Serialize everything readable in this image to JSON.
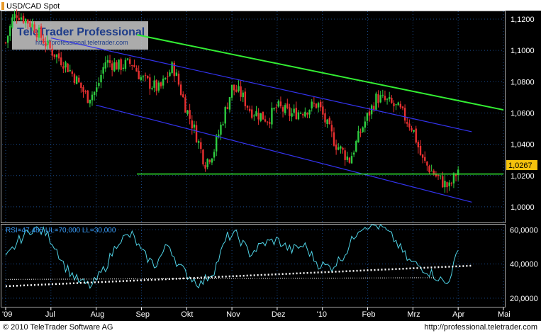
{
  "branding": {
    "logo": "TeleTrader Professional",
    "logo_url": "http://professional.teletrader.com"
  },
  "footer": {
    "copyright": "© 2010 TeleTrader Software AG",
    "url": "http://professional.teletrader.com"
  },
  "colors": {
    "background": "#000000",
    "up_candle": "#2ecc40",
    "down_candle": "#e83030",
    "channel_line": "#3333ee",
    "trend_line": "#33ee33",
    "rsi_line": "#4fd3e6",
    "grid": "#1a4a8a",
    "panel_border": "#a8a8a8"
  },
  "chart_data": [
    {
      "type": "candlestick",
      "title": "USD/CAD Spot",
      "last_value_label": "1,0267",
      "y_ticks": [
        {
          "value": 1.12,
          "label": "1,1200"
        },
        {
          "value": 1.1,
          "label": "1,1000"
        },
        {
          "value": 1.08,
          "label": "1,0800"
        },
        {
          "value": 1.06,
          "label": "1,0600"
        },
        {
          "value": 1.04,
          "label": "1,0400"
        },
        {
          "value": 1.02,
          "label": "1,0200"
        },
        {
          "value": 1.0,
          "label": "1,0000"
        }
      ],
      "ylim": [
        0.99,
        1.125
      ],
      "x_labels": [
        "'09",
        "Jul",
        "Aug",
        "Sep",
        "Okt",
        "Nov",
        "Dez",
        "'10",
        "Feb",
        "Mrz",
        "Apr",
        "Mai"
      ],
      "xlim": [
        0,
        11
      ],
      "close_anchors": [
        [
          0.0,
          1.105
        ],
        [
          0.15,
          1.12
        ],
        [
          0.25,
          1.124
        ],
        [
          0.6,
          1.116
        ],
        [
          1.0,
          1.1
        ],
        [
          1.3,
          1.092
        ],
        [
          1.5,
          1.084
        ],
        [
          1.8,
          1.07
        ],
        [
          2.0,
          1.074
        ],
        [
          2.2,
          1.093
        ],
        [
          2.5,
          1.09
        ],
        [
          2.8,
          1.092
        ],
        [
          3.0,
          1.082
        ],
        [
          3.4,
          1.075
        ],
        [
          3.7,
          1.09
        ],
        [
          4.0,
          1.062
        ],
        [
          4.2,
          1.047
        ],
        [
          4.4,
          1.028
        ],
        [
          4.6,
          1.036
        ],
        [
          4.8,
          1.056
        ],
        [
          5.0,
          1.076
        ],
        [
          5.2,
          1.072
        ],
        [
          5.4,
          1.062
        ],
        [
          5.8,
          1.056
        ],
        [
          6.0,
          1.064
        ],
        [
          6.3,
          1.059
        ],
        [
          6.6,
          1.062
        ],
        [
          6.9,
          1.066
        ],
        [
          7.1,
          1.052
        ],
        [
          7.3,
          1.04
        ],
        [
          7.6,
          1.03
        ],
        [
          7.9,
          1.052
        ],
        [
          8.2,
          1.07
        ],
        [
          8.45,
          1.067
        ],
        [
          8.7,
          1.062
        ],
        [
          9.0,
          1.05
        ],
        [
          9.2,
          1.03
        ],
        [
          9.5,
          1.02
        ],
        [
          9.8,
          1.012
        ],
        [
          10.0,
          1.024
        ]
      ],
      "channel_lines": [
        {
          "from": [
            1.0,
            1.108
          ],
          "to": [
            10.3,
            1.048
          ]
        },
        {
          "from": [
            2.0,
            1.065
          ],
          "to": [
            10.3,
            1.003
          ]
        }
      ],
      "resistance_line": {
        "from": [
          2.9,
          1.11
        ],
        "to": [
          11.0,
          1.062
        ]
      },
      "support_line": {
        "from": [
          2.9,
          1.021
        ],
        "to": [
          11.0,
          1.021
        ]
      }
    },
    {
      "type": "line",
      "title": "RSI=47,485  UL=70,000  LL=30,000",
      "y_ticks": [
        {
          "value": 60,
          "label": "60,0000"
        },
        {
          "value": 40,
          "label": "40,0000"
        },
        {
          "value": 20,
          "label": "20,0000"
        }
      ],
      "ylim": [
        15,
        63
      ],
      "rsi_anchors": [
        [
          0.0,
          43
        ],
        [
          0.3,
          54
        ],
        [
          0.6,
          61
        ],
        [
          0.9,
          58
        ],
        [
          1.1,
          50
        ],
        [
          1.3,
          39
        ],
        [
          1.6,
          30
        ],
        [
          1.9,
          27
        ],
        [
          2.2,
          38
        ],
        [
          2.5,
          54
        ],
        [
          2.8,
          57
        ],
        [
          3.0,
          47
        ],
        [
          3.3,
          39
        ],
        [
          3.6,
          52
        ],
        [
          3.8,
          40
        ],
        [
          4.0,
          34
        ],
        [
          4.3,
          28
        ],
        [
          4.6,
          36
        ],
        [
          4.9,
          56
        ],
        [
          5.1,
          57
        ],
        [
          5.4,
          46
        ],
        [
          5.7,
          52
        ],
        [
          6.0,
          54
        ],
        [
          6.3,
          48
        ],
        [
          6.6,
          51
        ],
        [
          6.9,
          40
        ],
        [
          7.2,
          38
        ],
        [
          7.5,
          46
        ],
        [
          7.8,
          61
        ],
        [
          8.0,
          63
        ],
        [
          8.3,
          62
        ],
        [
          8.6,
          54
        ],
        [
          8.9,
          42
        ],
        [
          9.2,
          38
        ],
        [
          9.5,
          33
        ],
        [
          9.75,
          28
        ],
        [
          10.0,
          47
        ]
      ],
      "dotted_trend_1": {
        "from": [
          0.0,
          27
        ],
        "to": [
          10.3,
          39
        ]
      },
      "dotted_trend_2": {
        "from": [
          0.0,
          31
        ],
        "to": [
          9.5,
          32
        ]
      }
    }
  ]
}
